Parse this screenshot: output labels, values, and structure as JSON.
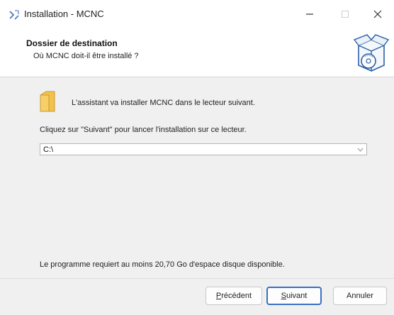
{
  "window": {
    "title": "Installation - MCNC",
    "icons": [
      "setup-app-icon",
      "minimize-icon",
      "maximize-icon",
      "close-icon"
    ]
  },
  "header": {
    "title": "Dossier de destination",
    "subtitle": "Où MCNC doit-il être installé ?",
    "icon": "installer-box-disc-icon"
  },
  "content": {
    "info_text": "L'assistant va installer MCNC dans le lecteur suivant.",
    "instruction_text": "Cliquez sur \"Suivant\" pour lancer l'installation sur ce lecteur.",
    "path_value": "C:\\",
    "space_text": "Le programme requiert au moins 20,70 Go d'espace disque disponible.",
    "folder_icon": "folder-icon"
  },
  "buttons": {
    "prev": {
      "accel": "P",
      "rest": "récédent"
    },
    "next": {
      "accel": "S",
      "rest": "uivant"
    },
    "cancel": "Annuler"
  },
  "colors": {
    "default_button_border": "#3a6fc4",
    "folder": "#f2c14e"
  }
}
